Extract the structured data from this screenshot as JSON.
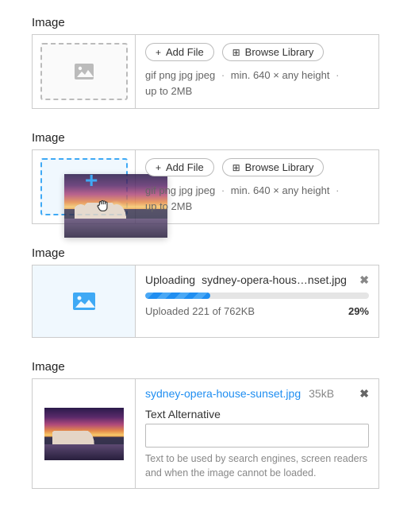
{
  "sections": {
    "empty": {
      "label": "Image"
    },
    "dragging": {
      "label": "Image"
    },
    "uploading": {
      "label": "Image"
    },
    "done": {
      "label": "Image"
    }
  },
  "buttons": {
    "add_file": "Add File",
    "browse_library": "Browse Library"
  },
  "hints": {
    "formats": "gif  png  jpg  jpeg",
    "dims": "min. 640 × any height",
    "size": "up to 2MB"
  },
  "uploading": {
    "status_label": "Uploading",
    "filename": "sydney-opera-hous…nset.jpg",
    "progress_text": "Uploaded 221 of 762KB",
    "percent_label": "29%",
    "percent_value": 29
  },
  "done": {
    "filename": "sydney-opera-house-sunset.jpg",
    "filesize": "35kB",
    "alt_label": "Text Alternative",
    "alt_value": "",
    "alt_help": "Text to be used by search engines, screen readers and when the image cannot be loaded."
  },
  "icons": {
    "plus": "+",
    "grid": "⊞",
    "cancel": "✖",
    "remove": "✖"
  }
}
